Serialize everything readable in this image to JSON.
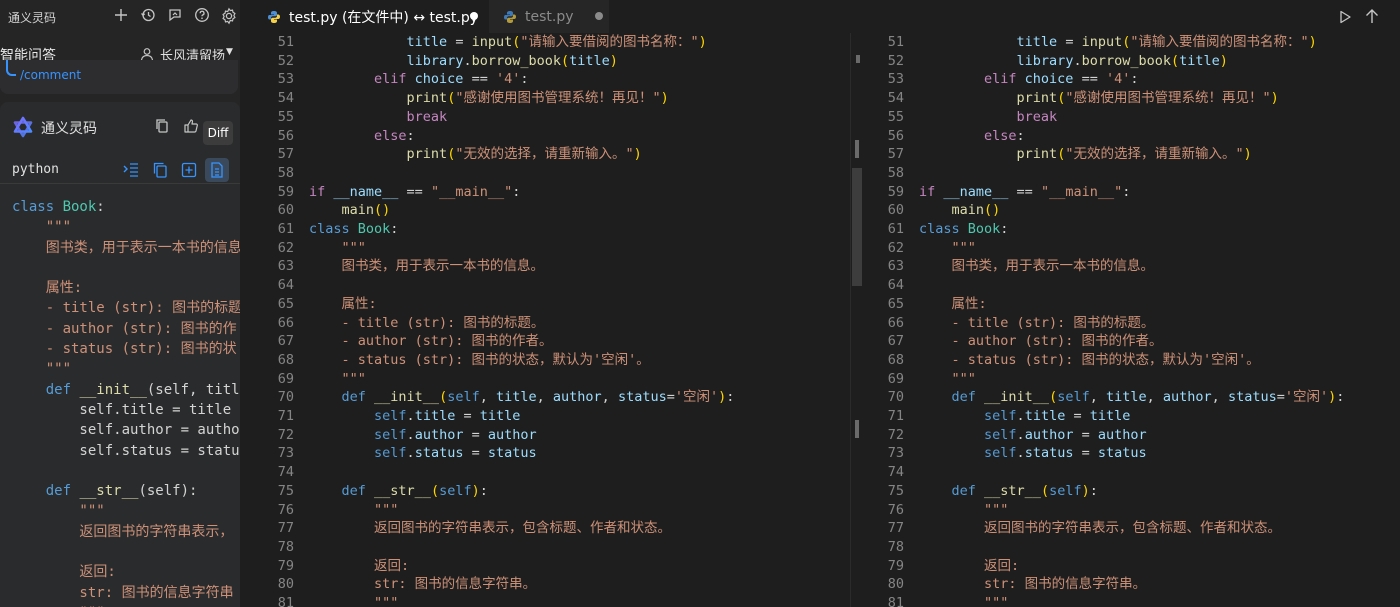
{
  "sidebar": {
    "title": "通义灵码",
    "mode": "智能问答",
    "user": "长风清留扬",
    "comment": "/comment",
    "agent_name": "通义灵码",
    "tooltip": "Diff",
    "code_lang": "python",
    "snippet": [
      [
        [
          "kb",
          "class "
        ],
        [
          "c",
          "Book"
        ],
        [
          "t",
          ":"
        ]
      ],
      [
        [
          "d",
          "    \"\"\""
        ]
      ],
      [
        [
          "d",
          "    图书类，用于表示一本书的信息"
        ]
      ],
      [
        [
          "t",
          ""
        ]
      ],
      [
        [
          "d",
          "    属性:"
        ]
      ],
      [
        [
          "d",
          "    - title (str): 图书的标题"
        ]
      ],
      [
        [
          "d",
          "    - author (str): 图书的作"
        ]
      ],
      [
        [
          "d",
          "    - status (str): 图书的状"
        ]
      ],
      [
        [
          "d",
          "    \"\"\""
        ]
      ],
      [
        [
          "kb",
          "    def "
        ],
        [
          "f",
          "__init__"
        ],
        [
          "t",
          "(self, titl"
        ]
      ],
      [
        [
          "t",
          "        self.title = title"
        ]
      ],
      [
        [
          "t",
          "        self.author = author"
        ]
      ],
      [
        [
          "t",
          "        self.status = statu"
        ]
      ],
      [
        [
          "t",
          ""
        ]
      ],
      [
        [
          "kb",
          "    def "
        ],
        [
          "f",
          "__str__"
        ],
        [
          "t",
          "(self):"
        ]
      ],
      [
        [
          "d",
          "        \"\"\""
        ]
      ],
      [
        [
          "d",
          "        返回图书的字符串表示，"
        ]
      ],
      [
        [
          "t",
          ""
        ]
      ],
      [
        [
          "d",
          "        返回:"
        ]
      ],
      [
        [
          "d",
          "        str: 图书的信息字符串"
        ]
      ],
      [
        [
          "d",
          "        \"\"\""
        ]
      ]
    ]
  },
  "tabs": [
    {
      "label": "test.py (在文件中) ↔ test.py",
      "active": true
    },
    {
      "label": "test.py",
      "active": false
    }
  ],
  "editor": {
    "lines": [
      {
        "n": "51",
        "tokens": [
          [
            "t",
            "            "
          ],
          [
            "v",
            "title"
          ],
          [
            "t",
            " = "
          ],
          [
            "f",
            "input"
          ],
          [
            "y",
            "("
          ],
          [
            "s",
            "\"请输入要借阅的图书名称：\""
          ],
          [
            "y",
            ")"
          ]
        ]
      },
      {
        "n": "52",
        "tokens": [
          [
            "t",
            "            "
          ],
          [
            "v",
            "library"
          ],
          [
            "t",
            "."
          ],
          [
            "f",
            "borrow_book"
          ],
          [
            "y",
            "("
          ],
          [
            "v",
            "title"
          ],
          [
            "y",
            ")"
          ]
        ]
      },
      {
        "n": "53",
        "tokens": [
          [
            "t",
            "        "
          ],
          [
            "k",
            "elif "
          ],
          [
            "v",
            "choice"
          ],
          [
            "t",
            " == "
          ],
          [
            "s",
            "'4'"
          ],
          [
            "t",
            ":"
          ]
        ]
      },
      {
        "n": "54",
        "tokens": [
          [
            "t",
            "            "
          ],
          [
            "f",
            "print"
          ],
          [
            "y",
            "("
          ],
          [
            "s",
            "\"感谢使用图书管理系统！再见！\""
          ],
          [
            "y",
            ")"
          ]
        ]
      },
      {
        "n": "55",
        "tokens": [
          [
            "t",
            "            "
          ],
          [
            "k",
            "break"
          ]
        ]
      },
      {
        "n": "56",
        "tokens": [
          [
            "t",
            "        "
          ],
          [
            "k",
            "else"
          ],
          [
            "t",
            ":"
          ]
        ]
      },
      {
        "n": "57",
        "tokens": [
          [
            "t",
            "            "
          ],
          [
            "f",
            "print"
          ],
          [
            "y",
            "("
          ],
          [
            "s",
            "\"无效的选择，请重新输入。\""
          ],
          [
            "y",
            ")"
          ]
        ]
      },
      {
        "n": "58",
        "tokens": []
      },
      {
        "n": "59",
        "tokens": [
          [
            "k",
            "if "
          ],
          [
            "v",
            "__name__"
          ],
          [
            "t",
            " == "
          ],
          [
            "s",
            "\"__main__\""
          ],
          [
            "t",
            ":"
          ]
        ]
      },
      {
        "n": "60",
        "tokens": [
          [
            "t",
            "    "
          ],
          [
            "f",
            "main"
          ],
          [
            "y",
            "()"
          ]
        ]
      },
      {
        "n": "61",
        "tokens": [
          [
            "kb",
            "class "
          ],
          [
            "c",
            "Book"
          ],
          [
            "t",
            ":"
          ]
        ]
      },
      {
        "n": "62",
        "tokens": [
          [
            "d",
            "    \"\"\""
          ]
        ]
      },
      {
        "n": "63",
        "tokens": [
          [
            "d",
            "    图书类，用于表示一本书的信息。"
          ]
        ]
      },
      {
        "n": "64",
        "tokens": []
      },
      {
        "n": "65",
        "tokens": [
          [
            "d",
            "    属性:"
          ]
        ]
      },
      {
        "n": "66",
        "tokens": [
          [
            "d",
            "    - title (str): 图书的标题。"
          ]
        ]
      },
      {
        "n": "67",
        "tokens": [
          [
            "d",
            "    - author (str): 图书的作者。"
          ]
        ]
      },
      {
        "n": "68",
        "tokens": [
          [
            "d",
            "    - status (str): 图书的状态，默认为'空闲'。"
          ]
        ]
      },
      {
        "n": "69",
        "tokens": [
          [
            "d",
            "    \"\"\""
          ]
        ]
      },
      {
        "n": "70",
        "tokens": [
          [
            "kb",
            "    def "
          ],
          [
            "f",
            "__init__"
          ],
          [
            "y",
            "("
          ],
          [
            "sf",
            "self"
          ],
          [
            "t",
            ", "
          ],
          [
            "v",
            "title"
          ],
          [
            "t",
            ", "
          ],
          [
            "v",
            "author"
          ],
          [
            "t",
            ", "
          ],
          [
            "v",
            "status"
          ],
          [
            "t",
            "="
          ],
          [
            "s",
            "'空闲'"
          ],
          [
            "y",
            ")"
          ],
          [
            "t",
            ":"
          ]
        ]
      },
      {
        "n": "71",
        "tokens": [
          [
            "sf",
            "        self"
          ],
          [
            "t",
            "."
          ],
          [
            "v",
            "title"
          ],
          [
            "t",
            " = "
          ],
          [
            "v",
            "title"
          ]
        ]
      },
      {
        "n": "72",
        "tokens": [
          [
            "sf",
            "        self"
          ],
          [
            "t",
            "."
          ],
          [
            "v",
            "author"
          ],
          [
            "t",
            " = "
          ],
          [
            "v",
            "author"
          ]
        ]
      },
      {
        "n": "73",
        "tokens": [
          [
            "sf",
            "        self"
          ],
          [
            "t",
            "."
          ],
          [
            "v",
            "status"
          ],
          [
            "t",
            " = "
          ],
          [
            "v",
            "status"
          ]
        ]
      },
      {
        "n": "74",
        "tokens": []
      },
      {
        "n": "75",
        "tokens": [
          [
            "kb",
            "    def "
          ],
          [
            "f",
            "__str__"
          ],
          [
            "y",
            "("
          ],
          [
            "sf",
            "self"
          ],
          [
            "y",
            ")"
          ],
          [
            "t",
            ":"
          ]
        ]
      },
      {
        "n": "76",
        "tokens": [
          [
            "d",
            "        \"\"\""
          ]
        ]
      },
      {
        "n": "77",
        "tokens": [
          [
            "d",
            "        返回图书的字符串表示，包含标题、作者和状态。"
          ]
        ]
      },
      {
        "n": "78",
        "tokens": []
      },
      {
        "n": "79",
        "tokens": [
          [
            "d",
            "        返回:"
          ]
        ]
      },
      {
        "n": "80",
        "tokens": [
          [
            "d",
            "        str: 图书的信息字符串。"
          ]
        ]
      },
      {
        "n": "81",
        "tokens": [
          [
            "d",
            "        \"\"\""
          ]
        ]
      }
    ]
  },
  "colors": {
    "keyword": "#c586c0",
    "storage": "#569cd6",
    "string": "#ce9178",
    "function": "#dcdcaa",
    "variable": "#9cdcfe",
    "class": "#4ec9b0",
    "accent": "#3794ff"
  }
}
